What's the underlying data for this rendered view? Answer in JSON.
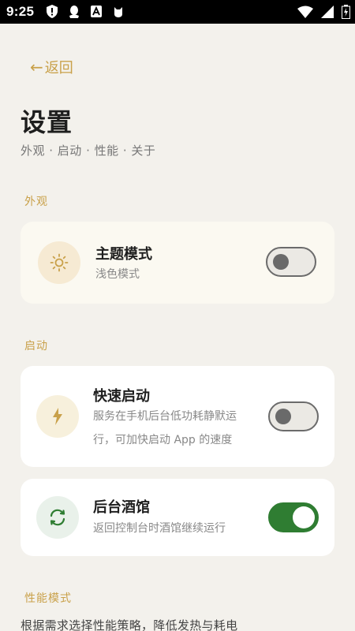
{
  "status_bar": {
    "time": "9:25",
    "left_icons": [
      "shield-alert-icon",
      "penguin-icon",
      "a-box-icon",
      "cat-icon"
    ],
    "right_icons": [
      "wifi-icon",
      "signal-icon",
      "battery-charging-icon"
    ]
  },
  "nav": {
    "back_label": "返回",
    "back_arrow": "←"
  },
  "header": {
    "title": "设置",
    "subtitle": "外观 · 启动 · 性能 · 关于"
  },
  "sections": {
    "appearance": {
      "label": "外观",
      "theme": {
        "title": "主题模式",
        "desc": "浅色模式",
        "icon": "sun-icon",
        "enabled": false
      }
    },
    "startup": {
      "label": "启动",
      "quick_start": {
        "title": "快速启动",
        "desc_line1": "服务在手机后台低功耗静默运",
        "desc_line2": "行，可加快启动 App 的速度",
        "icon": "lightning-icon",
        "enabled": false
      },
      "background_tavern": {
        "title": "后台酒馆",
        "desc": "返回控制台时酒馆继续运行",
        "icon": "sync-icon",
        "enabled": true
      }
    },
    "performance": {
      "label": "性能模式",
      "desc": "根据需求选择性能策略，降低发热与耗电"
    }
  },
  "colors": {
    "accent": "#c9a14a",
    "toggle_on": "#2f7d32",
    "background": "#f3f1ec"
  }
}
